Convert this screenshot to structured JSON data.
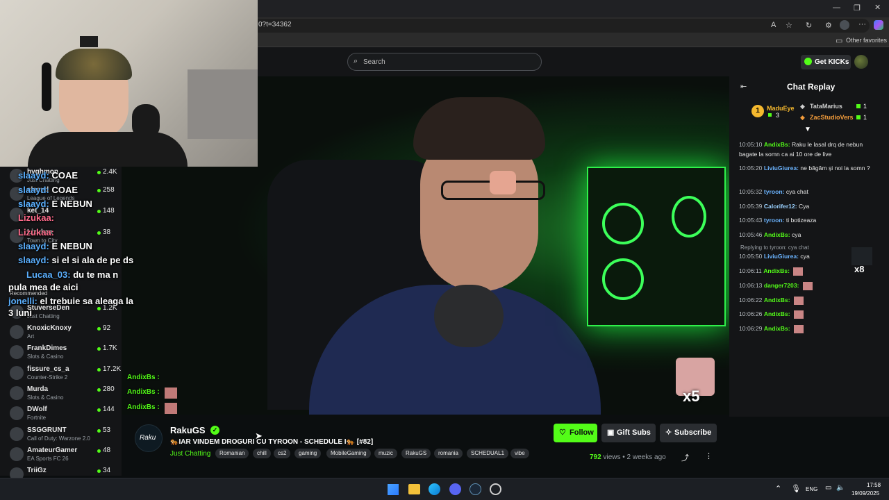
{
  "browser": {
    "url_fragment": "0?t=34362",
    "other_favorites": "Other favorites"
  },
  "header": {
    "search_placeholder": "Search",
    "get_kicks": "Get KICKs"
  },
  "sidebar": {
    "items": [
      {
        "name": "hvghmon",
        "category": "Just Chatting",
        "count": "2.4K"
      },
      {
        "name": "slaayd",
        "category": "League of Legends",
        "count": "258"
      },
      {
        "name": "ket_14",
        "category": "",
        "count": "148"
      },
      {
        "name": "Lizukaa",
        "category": "Town to City",
        "count": "38"
      },
      {
        "name": "StuverseDen",
        "category": "Just Chatting",
        "count": "1.2K"
      },
      {
        "name": "KnoxicKnoxy",
        "category": "Art",
        "count": "92"
      },
      {
        "name": "FrankDimes",
        "category": "Slots & Casino",
        "count": "1.7K"
      },
      {
        "name": "fissure_cs_a",
        "category": "Counter-Strike 2",
        "count": "17.2K"
      },
      {
        "name": "Murda",
        "category": "Slots & Casino",
        "count": "280"
      },
      {
        "name": "DWolf",
        "category": "Fortnite",
        "count": "144"
      },
      {
        "name": "SSGGRUNT",
        "category": "Call of Duty: Warzone 2.0",
        "count": "53"
      },
      {
        "name": "AmateurGamer",
        "category": "EA Sports FC 26",
        "count": "48"
      },
      {
        "name": "TriiGz",
        "category": "",
        "count": "34"
      }
    ],
    "recommended_label": "Recommended"
  },
  "overlay_chat": [
    {
      "name": "slaayd:",
      "text": "COAE"
    },
    {
      "name": "slaayd:",
      "text": "COAE"
    },
    {
      "name": "slaayd:",
      "text": "E NEBUN"
    },
    {
      "name": "Lizukaa:",
      "text": ""
    },
    {
      "name": "Lizukaa:",
      "text": ""
    },
    {
      "name": "slaayd:",
      "text": "E NEBUN"
    },
    {
      "name": "slaayd:",
      "text": "si el si ala de pe ds"
    },
    {
      "name": "Lucaa_03:",
      "text": "du te ma n"
    },
    {
      "name": "",
      "text": "pula mea de aici"
    },
    {
      "name": "jonelli:",
      "text": "el trebuie sa aleaga la"
    },
    {
      "name": "",
      "text": "3 luni"
    }
  ],
  "video_overlay": {
    "bottom_chat": [
      {
        "name": "AndixBs :"
      },
      {
        "name": "AndixBs :"
      },
      {
        "name": "AndixBs :"
      }
    ],
    "multiplier": "x5"
  },
  "chat_replay": {
    "title": "Chat Replay",
    "leaders": [
      {
        "name": "MaduEye",
        "count": "3",
        "rank": "1"
      },
      {
        "name": "TataMarius",
        "count": "1"
      },
      {
        "name": "ZacStudioVers",
        "count": "1"
      }
    ],
    "reply_note": "Replying to tyroon: cya chat",
    "badge_count": "x8",
    "messages": [
      {
        "time": "10:05:10",
        "user": "AndixBs:",
        "text": "Raku le lasal drq de nebun bagate la somn ca ai 10 ore de live"
      },
      {
        "time": "10:05:20",
        "user": "LiviuGiurea:",
        "text": "ne băgăm și noi la somn ?"
      },
      {
        "time": "10:05:32",
        "user": "tyroon:",
        "text": "cya chat"
      },
      {
        "time": "10:05:39",
        "user": "Calorifer12:",
        "text": "Cya"
      },
      {
        "time": "10:05:43",
        "user": "tyroon:",
        "text": "ti botizeaza"
      },
      {
        "time": "10:05:46",
        "user": "AndixBs:",
        "text": "cya"
      },
      {
        "time": "10:05:50",
        "user": "LiviuGiurea:",
        "text": "cya"
      },
      {
        "time": "10:06:11",
        "user": "AndixBs:",
        "text": ""
      },
      {
        "time": "10:06:13",
        "user": "danger7203:",
        "text": ""
      },
      {
        "time": "10:06:22",
        "user": "AndixBs:",
        "text": ""
      },
      {
        "time": "10:06:26",
        "user": "AndixBs:",
        "text": ""
      },
      {
        "time": "10:06:29",
        "user": "AndixBs:",
        "text": ""
      }
    ]
  },
  "stream": {
    "channel": "RakuGS",
    "avatar_text": "Raku",
    "title": "🐅IAR VINDEM DROGURI CU TYROON - SCHEDULE I🐅 [#82]",
    "category": "Just Chatting",
    "tags": [
      "Romanian",
      "chill",
      "cs2",
      "gaming",
      "MobileGaming",
      "muzic",
      "RakuGS",
      "romania",
      "SCHEDUAL1",
      "vibe"
    ],
    "follow": "Follow",
    "gift": "Gift Subs",
    "subscribe": "Subscribe",
    "views": "792",
    "views_label": "views",
    "ago": "2 weeks ago"
  },
  "taskbar": {
    "lang": "ENG",
    "time": "17:58",
    "date": "19/09/2025"
  },
  "colors": {
    "kick_green": "#53fc18",
    "bg": "#0b0e0f",
    "panel": "#141517"
  }
}
